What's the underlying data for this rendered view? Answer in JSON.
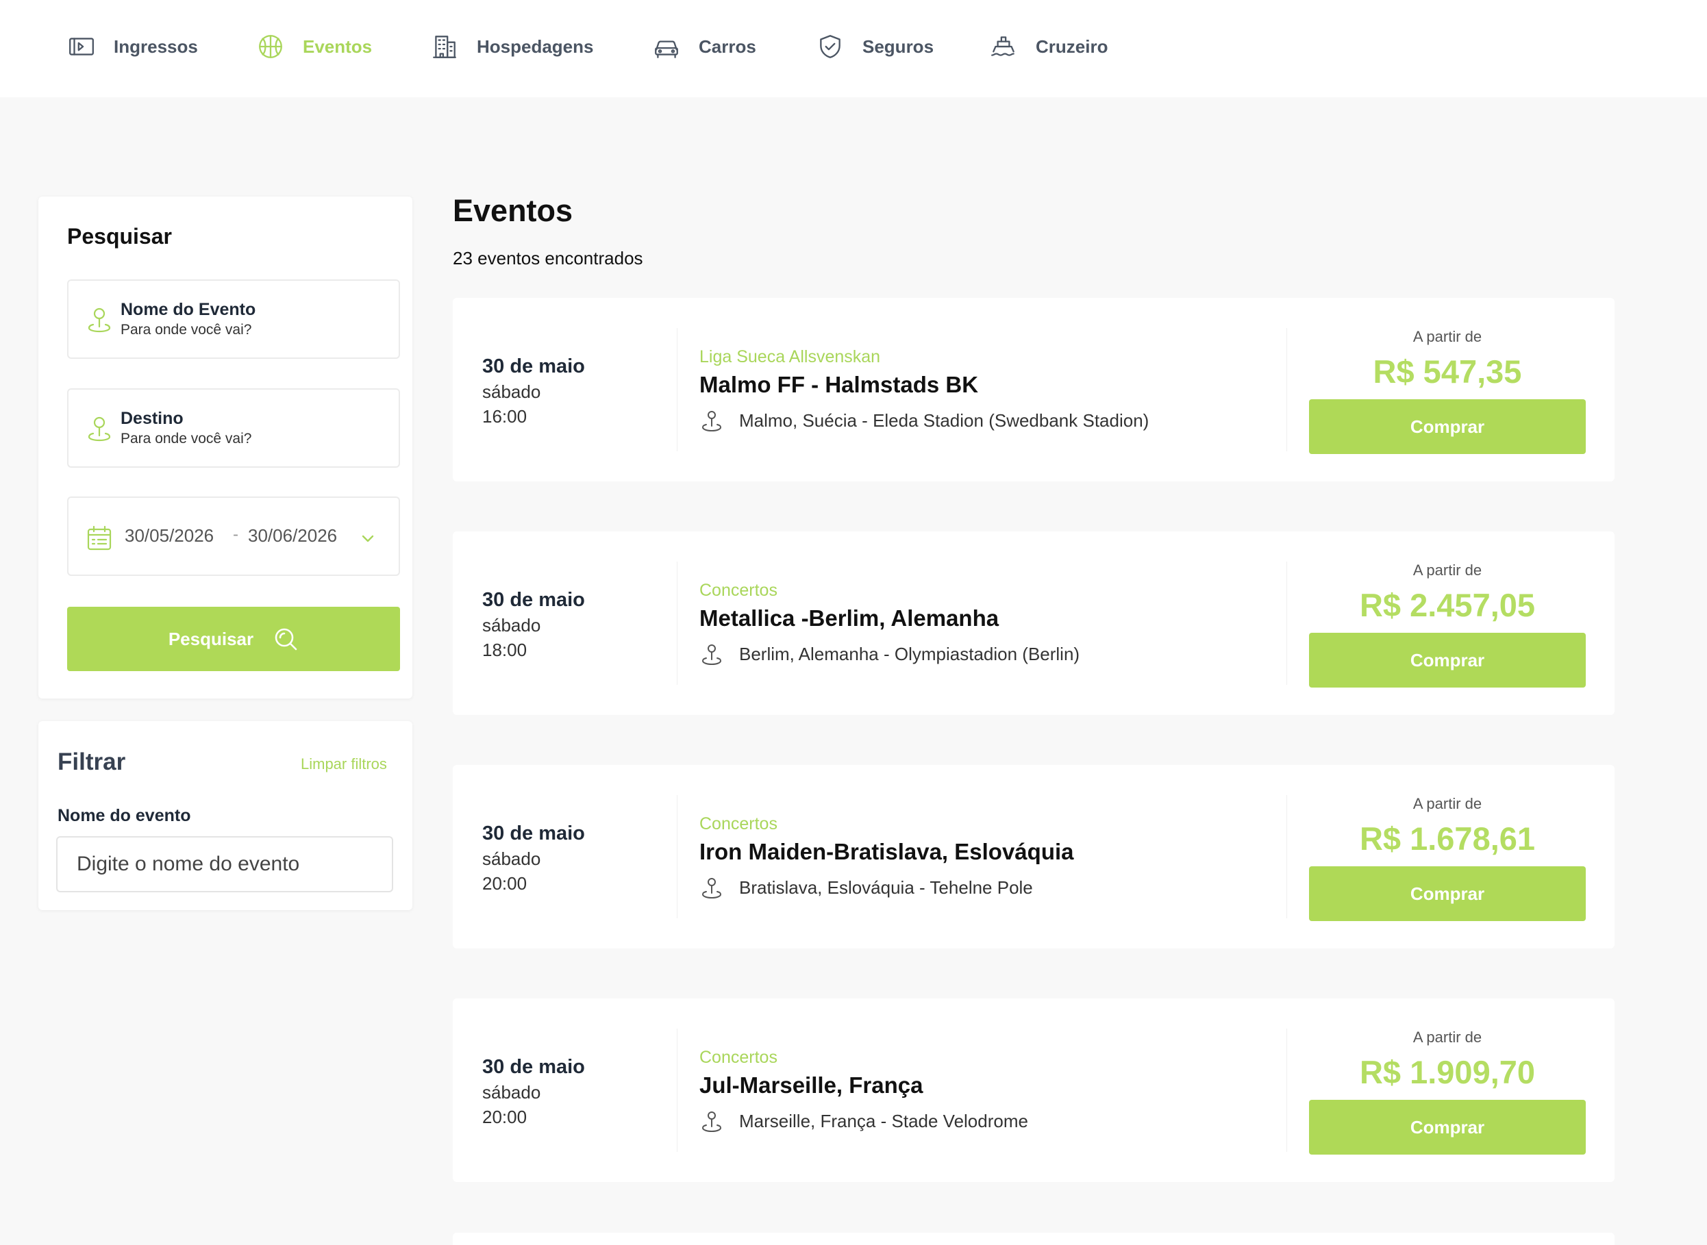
{
  "nav": {
    "items": [
      {
        "label": "Ingressos",
        "icon": "ticket-icon"
      },
      {
        "label": "Eventos",
        "icon": "basketball-icon"
      },
      {
        "label": "Hospedagens",
        "icon": "building-icon"
      },
      {
        "label": "Carros",
        "icon": "car-icon"
      },
      {
        "label": "Seguros",
        "icon": "shield-icon"
      },
      {
        "label": "Cruzeiro",
        "icon": "ship-icon"
      }
    ],
    "active": "Eventos"
  },
  "search": {
    "title": "Pesquisar",
    "event_name_field": {
      "title": "Nome do Evento",
      "subtitle": "Para onde você vai?"
    },
    "destination_field": {
      "title": "Destino",
      "subtitle": "Para onde você vai?"
    },
    "date_range": {
      "start": "30/05/2026",
      "separator": "-",
      "end": "30/06/2026"
    },
    "button_label": "Pesquisar"
  },
  "filter": {
    "title": "Filtrar",
    "clear_label": "Limpar filtros",
    "event_name_label": "Nome do evento",
    "event_name_placeholder": "Digite o nome do evento",
    "event_name_value": ""
  },
  "main": {
    "title": "Eventos",
    "count_text": "23 eventos encontrados"
  },
  "events": [
    {
      "date": "30 de maio",
      "weekday": "sábado",
      "time": "16:00",
      "category": "Liga Sueca Allsvenskan",
      "name": "Malmo FF - Halmstads BK",
      "venue": "Malmo, Suécia - Eleda Stadion (Swedbank Stadion)",
      "price_label": "A partir de",
      "price": "R$ 547,35",
      "button": "Comprar"
    },
    {
      "date": "30 de maio",
      "weekday": "sábado",
      "time": "18:00",
      "category": "Concertos",
      "name": "Metallica -Berlim, Alemanha",
      "venue": "Berlim, Alemanha - Olympiastadion (Berlin)",
      "price_label": "A partir de",
      "price": "R$ 2.457,05",
      "button": "Comprar"
    },
    {
      "date": "30 de maio",
      "weekday": "sábado",
      "time": "20:00",
      "category": "Concertos",
      "name": "Iron Maiden-Bratislava, Eslováquia",
      "venue": "Bratislava, Eslováquia - Tehelne Pole",
      "price_label": "A partir de",
      "price": "R$ 1.678,61",
      "button": "Comprar"
    },
    {
      "date": "30 de maio",
      "weekday": "sábado",
      "time": "20:00",
      "category": "Concertos",
      "name": "Jul-Marseille, França",
      "venue": "Marseille, França - Stade Velodrome",
      "price_label": "A partir de",
      "price": "R$ 1.909,70",
      "button": "Comprar"
    }
  ],
  "colors": {
    "accent": "#afd957",
    "accent_text": "#a9d65a",
    "background": "#f8f8f8",
    "nav_text": "#4b5563"
  }
}
